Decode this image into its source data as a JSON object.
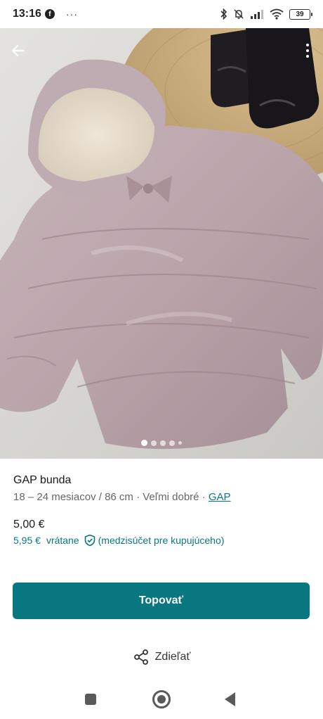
{
  "status_bar": {
    "time": "13:16",
    "facebook_glyph": "f",
    "more_glyph": "···",
    "battery_level": "39",
    "icons": [
      "bluetooth-icon",
      "mute-icon",
      "signal-icon",
      "wifi-icon",
      "battery-icon"
    ]
  },
  "photo": {
    "image_count": 5,
    "active_index": 0
  },
  "item": {
    "title": "GAP bunda",
    "meta": "18 – 24 mesiacov / 86 cm · Veľmi dobré · ",
    "brand": "GAP"
  },
  "pricing": {
    "price": "5,00 €",
    "total_amount": "5,95 €",
    "included_label": "vrátane",
    "protection_note": "(medzisúčet pre kupujúceho)"
  },
  "actions": {
    "buy_label": "Topovať",
    "share_label": "Zdieľať"
  },
  "colors": {
    "accent": "#097780",
    "button_text": "#ffffff"
  }
}
